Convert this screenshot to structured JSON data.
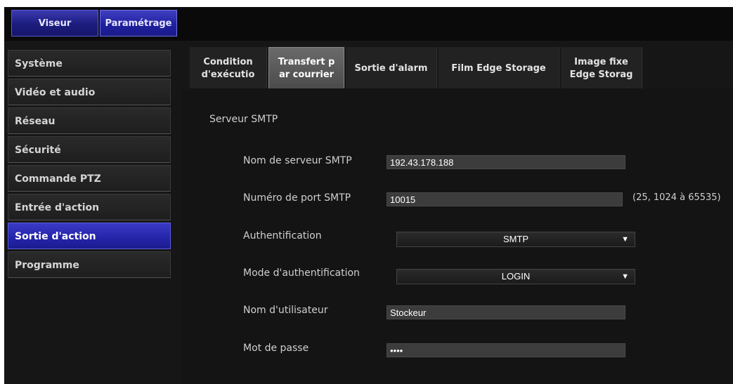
{
  "topnav": {
    "viewer_label": "Viseur",
    "settings_label": "Paramétrage"
  },
  "sidebar": {
    "items": [
      {
        "label": "Système"
      },
      {
        "label": "Vidéo et audio"
      },
      {
        "label": "Réseau"
      },
      {
        "label": "Sécurité"
      },
      {
        "label": "Commande PTZ"
      },
      {
        "label": "Entrée d'action"
      },
      {
        "label": "Sortie d'action",
        "active": true
      },
      {
        "label": "Programme"
      }
    ]
  },
  "tabs": [
    {
      "label": "Condition\nd'exécutio"
    },
    {
      "label": "Transfert p\nar courrier",
      "active": true
    },
    {
      "label": "Sortie d'alarm"
    },
    {
      "label": "Film Edge Storage"
    },
    {
      "label": "Image fixe\nEdge Storag"
    }
  ],
  "form": {
    "section_title": "Serveur SMTP",
    "server_name_label": "Nom de serveur SMTP",
    "server_name_value": "192.43.178.188",
    "port_label": "Numéro de port SMTP",
    "port_value": "10015",
    "port_hint": "(25, 1024 à 65535)",
    "auth_label": "Authentification",
    "auth_value": "SMTP",
    "auth_mode_label": "Mode d'authentification",
    "auth_mode_value": "LOGIN",
    "username_label": "Nom d'utilisateur",
    "username_value": "Stockeur",
    "password_label": "Mot de passe",
    "password_value": "••••"
  },
  "colors": {
    "accent": "#2424a8",
    "background": "#161616"
  }
}
